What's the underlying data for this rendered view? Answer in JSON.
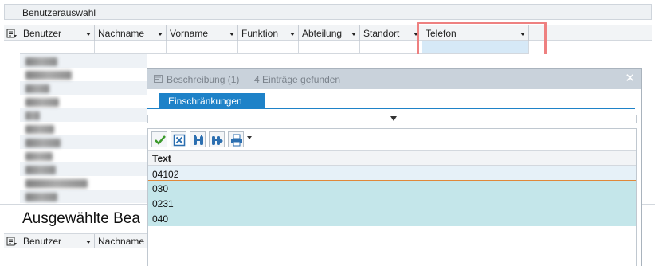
{
  "window": {
    "title": "Benutzerauswahl"
  },
  "grid": {
    "columns": [
      {
        "label": "Benutzer"
      },
      {
        "label": "Nachname"
      },
      {
        "label": "Vorname"
      },
      {
        "label": "Funktion"
      },
      {
        "label": "Abteilung"
      },
      {
        "label": "Standort"
      },
      {
        "label": "Telefon"
      }
    ],
    "filter_values": {
      "telefon": ""
    }
  },
  "bottom_section": {
    "title": "Ausgewählte Bea",
    "columns": [
      {
        "label": "Benutzer"
      },
      {
        "label": "Nachname"
      }
    ]
  },
  "dialog": {
    "title": "Beschreibung (1)",
    "info": "4 Einträge gefunden",
    "close_label": "✕",
    "tab": "Einschränkungen",
    "toolbar": [
      {
        "name": "accept-icon"
      },
      {
        "name": "cancel-icon"
      },
      {
        "name": "find-icon"
      },
      {
        "name": "find-next-icon"
      },
      {
        "name": "print-icon"
      }
    ],
    "column_header": "Text",
    "rows": [
      "04102",
      "030",
      "0231",
      "040"
    ],
    "selected_row": 0
  },
  "colors": {
    "accent": "#1e82c8",
    "highlight_frame": "#ee8080",
    "row_background": "#c4e6ea",
    "selected_border": "#e0883a"
  }
}
